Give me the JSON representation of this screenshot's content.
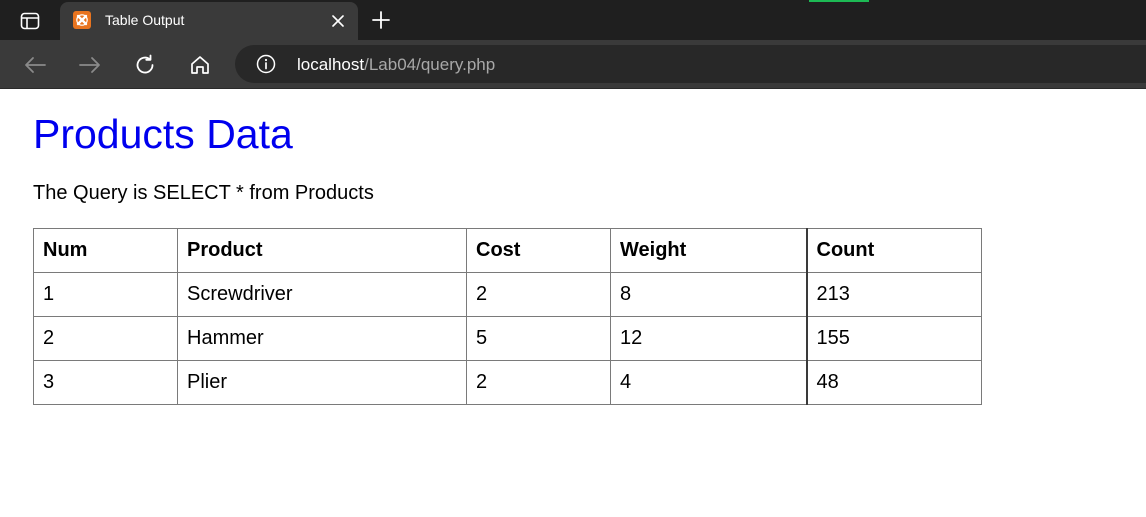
{
  "browser": {
    "tab": {
      "title": "Table Output",
      "favicon": "xampp-icon"
    },
    "address": {
      "host": "localhost",
      "path": "/Lab04/query.php"
    },
    "colors": {
      "tabstrip": "#1f1f1f",
      "toolbar": "#3a3a3a",
      "accent": "#1db954"
    }
  },
  "page": {
    "title": "Products Data",
    "query_text": "The Query is SELECT * from Products",
    "title_color": "#0000ee",
    "table": {
      "headers": [
        "Num",
        "Product",
        "Cost",
        "Weight",
        "Count"
      ],
      "rows": [
        [
          "1",
          "Screwdriver",
          "2",
          "8",
          "213"
        ],
        [
          "2",
          "Hammer",
          "5",
          "12",
          "155"
        ],
        [
          "3",
          "Plier",
          "2",
          "4",
          "48"
        ]
      ]
    }
  }
}
